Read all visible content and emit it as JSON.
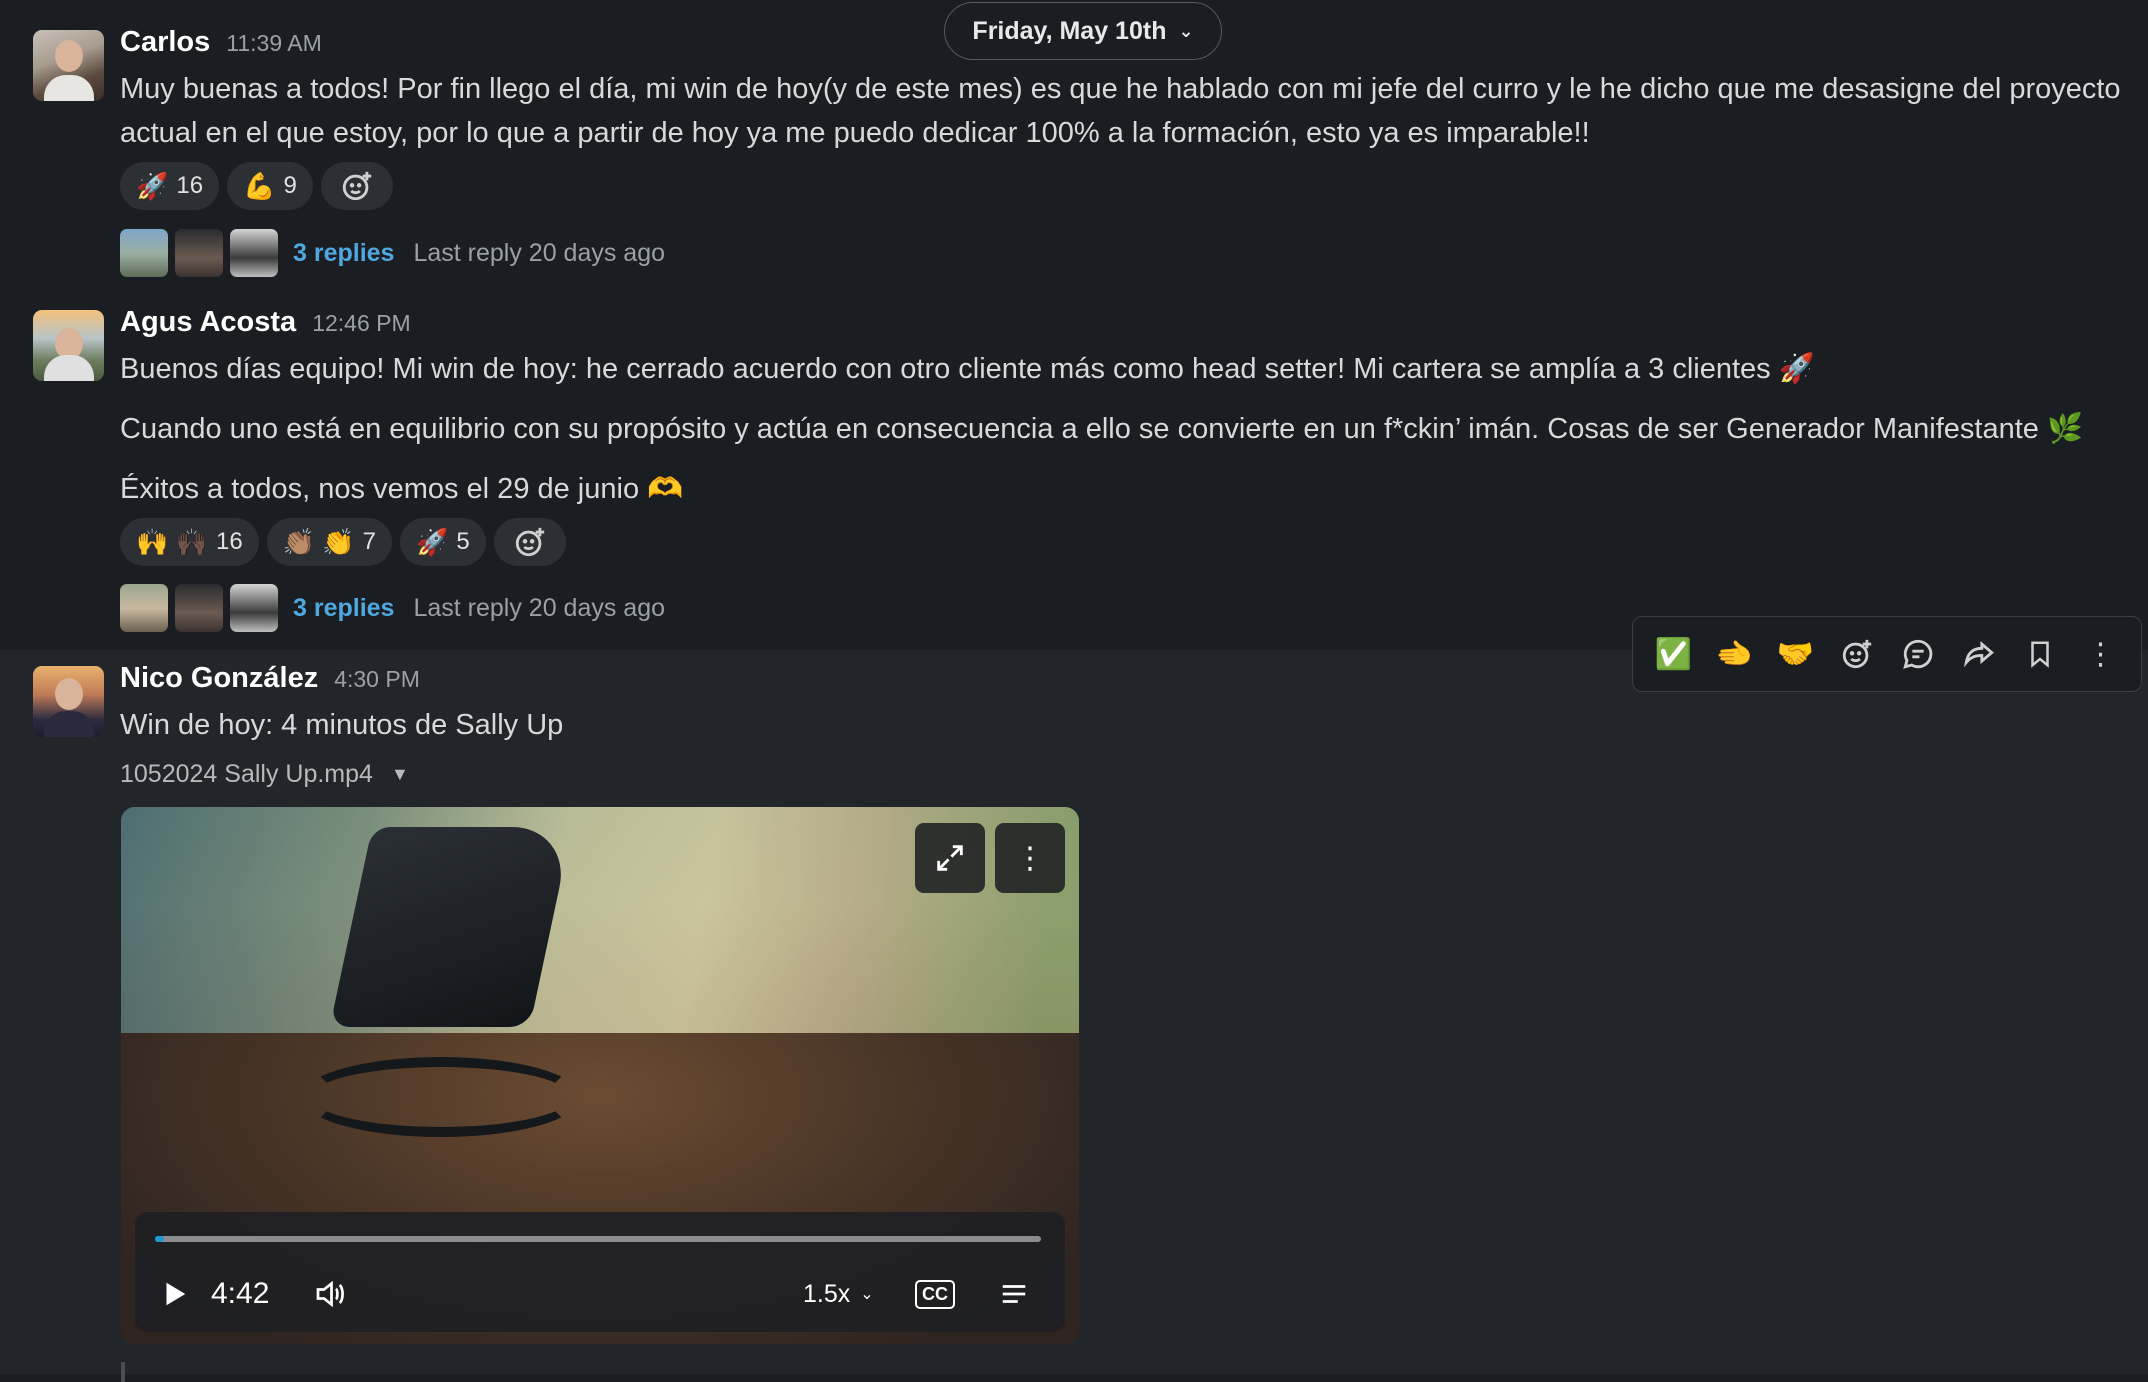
{
  "date_divider": {
    "label": "Friday, May 10th",
    "chevron": "chevron-down-icon"
  },
  "messages": [
    {
      "author": "Carlos",
      "time": "11:39 AM",
      "paragraphs": [
        "Muy buenas a todos! Por fin llego el día, mi win de hoy(y de este mes) es que he hablado con mi jefe del curro y le he dicho que me desasigne del proyecto actual en el que estoy, por lo que a partir de hoy ya me puedo dedicar 100% a la formación, esto ya es imparable!!"
      ],
      "reactions": [
        {
          "emoji": "🚀",
          "count": "16"
        },
        {
          "emoji": "💪",
          "count": "9"
        }
      ],
      "thread": {
        "replies": "3 replies",
        "last_reply": "Last reply 20 days ago"
      }
    },
    {
      "author": "Agus Acosta",
      "time": "12:46 PM",
      "paragraphs": [
        "Buenos días equipo! Mi win de hoy: he cerrado acuerdo con otro cliente más como head setter! Mi cartera se amplía a 3 clientes 🚀",
        "Cuando uno está en equilibrio con su propósito y actúa en consecuencia a ello se convierte en un f*ckin’ imán. Cosas de ser Generador Manifestante 🌿",
        "Éxitos a todos, nos vemos el 29 de junio 🫶"
      ],
      "reactions": [
        {
          "emoji": "🙌 🙌🏿",
          "count": "16"
        },
        {
          "emoji": "👏🏽 👏",
          "count": "7"
        },
        {
          "emoji": "🚀",
          "count": "5"
        }
      ],
      "thread": {
        "replies": "3 replies",
        "last_reply": "Last reply 20 days ago"
      }
    },
    {
      "author": "Nico González",
      "time": "4:30 PM",
      "paragraphs": [
        "Win de hoy: 4 minutos de Sally Up"
      ],
      "attachment": {
        "filename": "1052024 Sally Up.mp4",
        "duration": "4:42",
        "speed": "1.5x",
        "cc_label": "CC",
        "progress": 0.01
      }
    }
  ],
  "hover_toolbar": {
    "items": [
      {
        "icon": "✅",
        "name": "check-reaction-icon"
      },
      {
        "icon": "🫲",
        "name": "hand-reaction-icon"
      },
      {
        "icon": "🤝",
        "name": "handshake-reaction-icon"
      },
      {
        "icon": "☺+",
        "name": "add-reaction-icon"
      },
      {
        "icon": "💬",
        "name": "reply-in-thread-icon"
      },
      {
        "icon": "➦",
        "name": "share-icon"
      },
      {
        "icon": "🔖",
        "name": "bookmark-icon"
      },
      {
        "icon": "⋮",
        "name": "more-actions-icon"
      }
    ]
  },
  "colors": {
    "background": "#1a1d21",
    "hover_background": "#222529",
    "link": "#4fa8e0",
    "progress": "#1d9bd1"
  }
}
